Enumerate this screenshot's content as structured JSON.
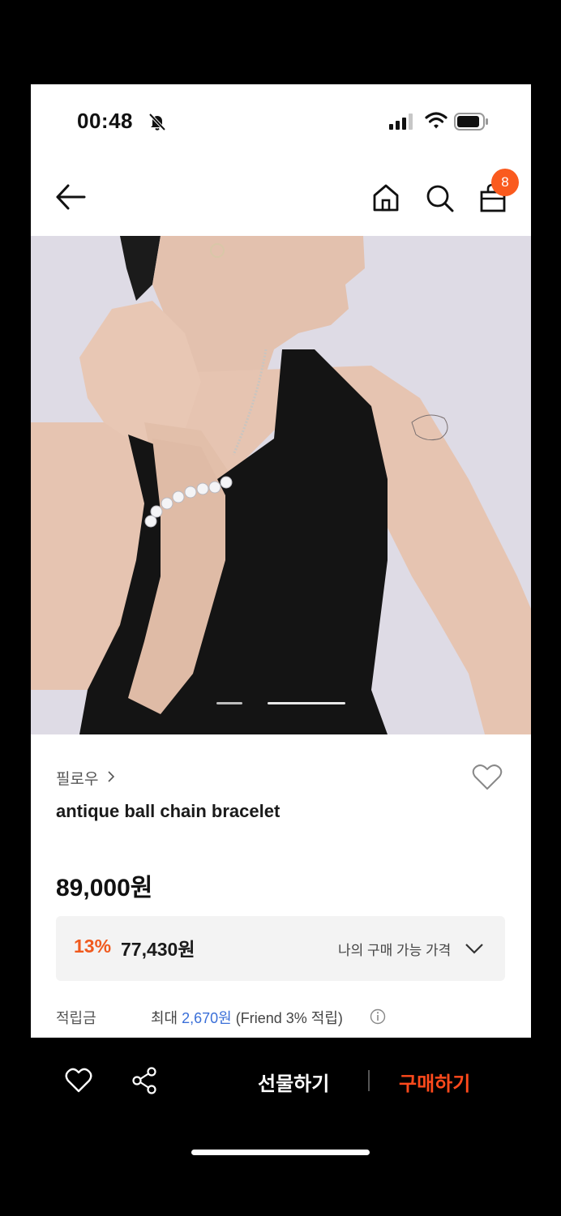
{
  "status_bar": {
    "time": "00:48"
  },
  "nav": {
    "cart_count": "8"
  },
  "product": {
    "brand": "필로우",
    "name": "antique ball chain bracelet",
    "price": "89,000원",
    "discount_rate": "13%",
    "discount_price": "77,430원",
    "my_price_label": "나의 구매 가능 가격",
    "points_label": "적립금",
    "points_prefix": "최대 ",
    "points_amount": "2,670원",
    "points_suffix": " (Friend 3% 적립)"
  },
  "bottom_bar": {
    "gift_label": "선물하기",
    "buy_label": "구매하기"
  },
  "colors": {
    "accent": "#fa5a1e",
    "link": "#3a6fd8"
  },
  "icons": [
    "back-arrow-icon",
    "home-icon",
    "search-icon",
    "shopping-bag-icon",
    "heart-icon",
    "share-icon",
    "info-icon",
    "bell-slash-icon"
  ]
}
